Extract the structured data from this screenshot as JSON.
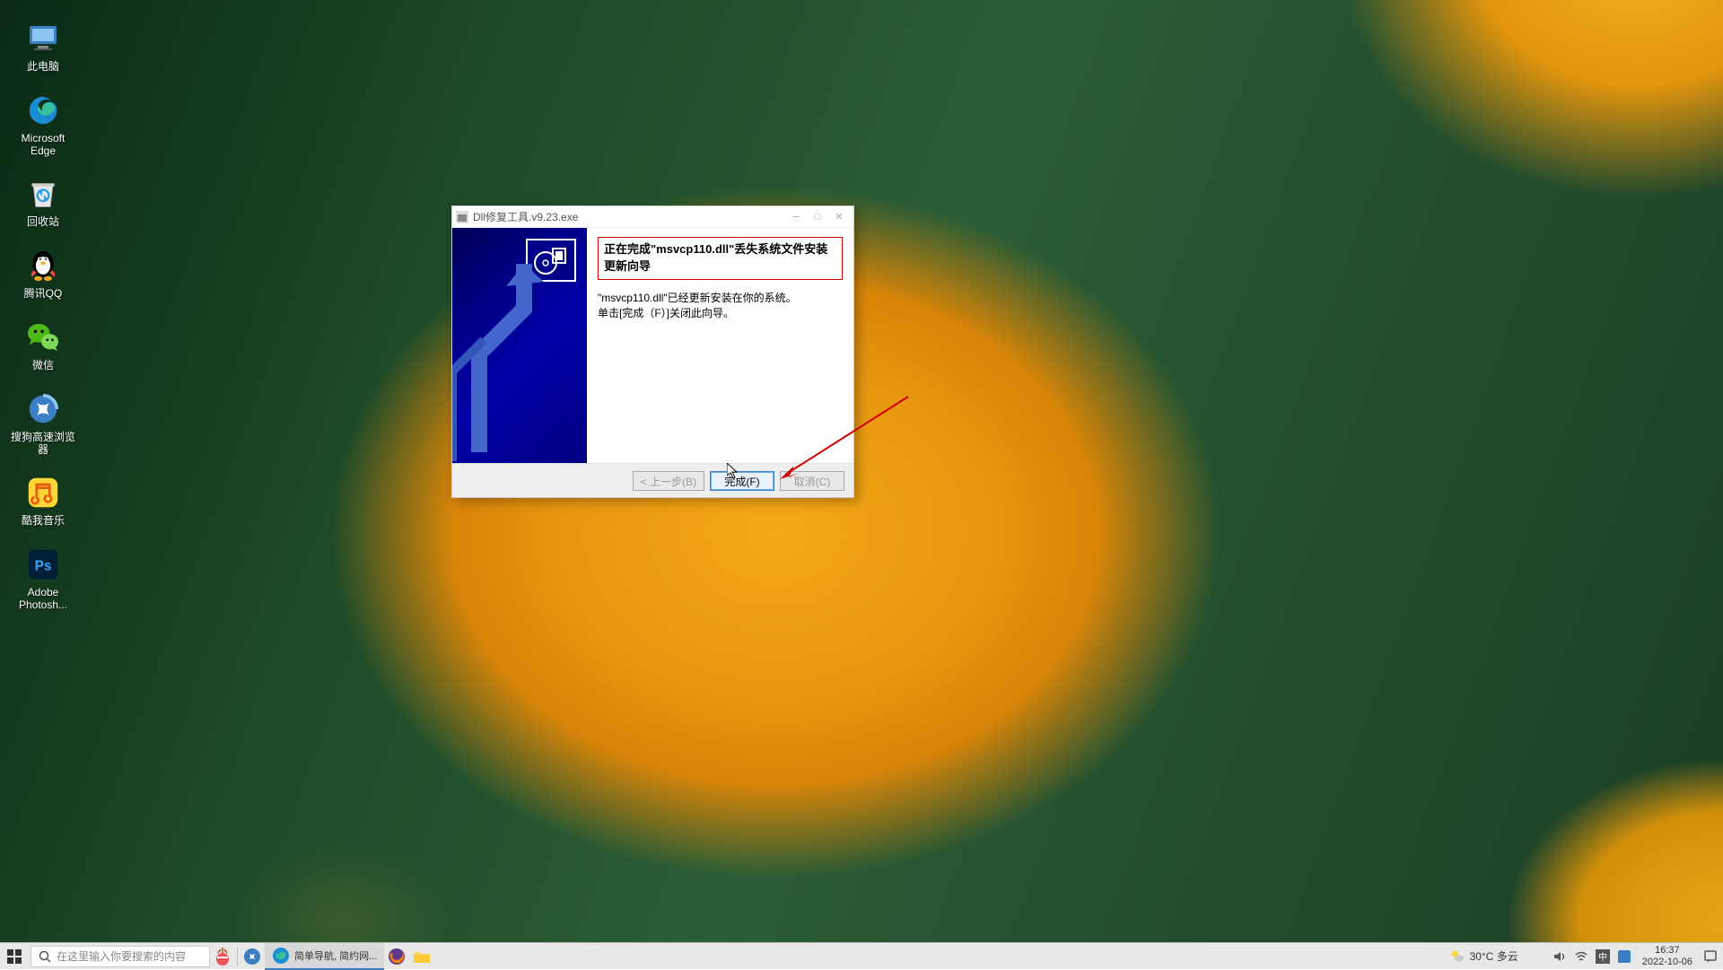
{
  "desktop": {
    "icons": [
      {
        "name": "此电脑",
        "id": "this-pc"
      },
      {
        "name": "Microsoft Edge",
        "id": "edge"
      },
      {
        "name": "回收站",
        "id": "recycle-bin"
      },
      {
        "name": "腾讯QQ",
        "id": "qq"
      },
      {
        "name": "微信",
        "id": "wechat"
      },
      {
        "name": "搜狗高速浏览器",
        "id": "sogou-browser"
      },
      {
        "name": "酷我音乐",
        "id": "kuwo-music"
      },
      {
        "name": "Adobe Photosh...",
        "id": "photoshop"
      }
    ]
  },
  "dialog": {
    "title": "Dll修复工具.v9.23.exe",
    "header": "正在完成\"msvcp110.dll\"丢失系统文件安装更新向导",
    "body1": "\"msvcp110.dll\"已经更新安装在你的系统。",
    "body2": "单击[完成（F）]关闭此向导。",
    "btn_back": "< 上一步(B)",
    "btn_finish": "完成(F)",
    "btn_cancel": "取消(C)"
  },
  "taskbar": {
    "search_placeholder": "在这里输入你要搜索的内容",
    "tab1": "简单导航, 简约网...",
    "weather_temp": "30°C 多云",
    "time": "16:37",
    "date": "2022-10-06"
  }
}
